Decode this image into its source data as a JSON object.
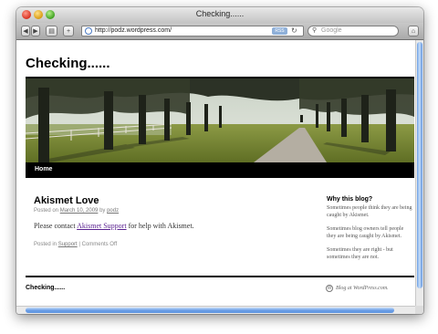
{
  "window": {
    "title": "Checking......"
  },
  "toolbar": {
    "back_icon": "back-arrow-icon",
    "forward_icon": "forward-arrow-icon",
    "url": "http://podz.wordpress.com/",
    "rss_label": "RSS",
    "search_placeholder": "Google"
  },
  "site": {
    "title": "Checking......",
    "nav": [
      "Home"
    ]
  },
  "post": {
    "title": "Akismet Love",
    "posted_on": "Posted on",
    "date": "March 10, 2009",
    "by": "by",
    "author": "podz",
    "body_prefix": "Please contact",
    "body_link": "Akismet Support",
    "body_suffix": "for help with Akismet.",
    "posted_in": "Posted in",
    "category": "Support",
    "separator": "|",
    "comments": "Comments Off"
  },
  "sidebar": {
    "heading": "Why this blog?",
    "paragraphs": [
      "Sometimes people think they are being caught by Akismet.",
      "Sometimes blog owners tell people they are being caught by Akismet.",
      "Sometimes they are right - but sometimes they are not."
    ]
  },
  "footer": {
    "title": "Checking......",
    "credit": "Blog at WordPress.com."
  }
}
